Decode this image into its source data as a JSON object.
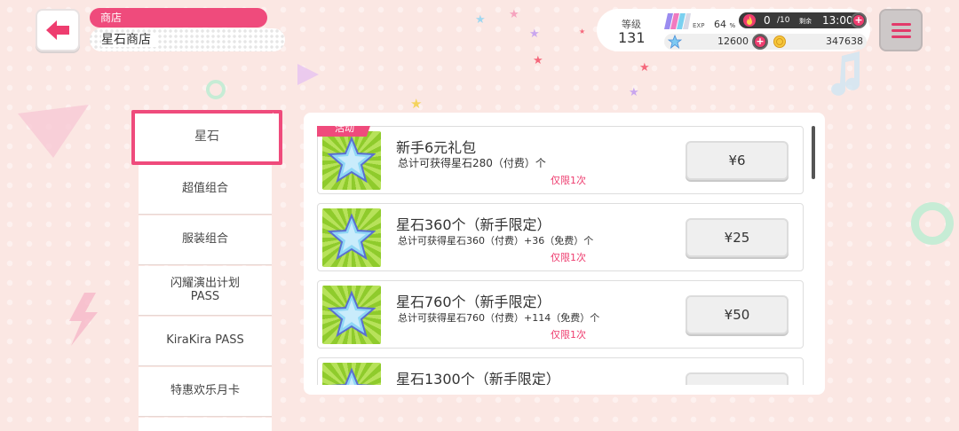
{
  "header": {
    "breadcrumb_top": "商店",
    "page_title": "星石商店"
  },
  "status": {
    "level_label": "等级",
    "level_value": "131",
    "exp_label": "EXP",
    "exp_percent": "64",
    "exp_unit": "%",
    "stamina_current": "0",
    "stamina_max": "/10",
    "remaining_label": "剩余",
    "remaining_time": "13:00",
    "gems": "12600",
    "coins": "347638"
  },
  "sidebar": {
    "items": [
      {
        "label": "星石"
      },
      {
        "label": "超值组合"
      },
      {
        "label": "服装组合"
      },
      {
        "label": "闪耀演出计划\nPASS"
      },
      {
        "label": "KiraKira PASS"
      },
      {
        "label": "特惠欢乐月卡"
      }
    ]
  },
  "products": [
    {
      "tag": "活动",
      "title": "新手6元礼包",
      "desc": "总计可获得星石280（付费）个",
      "limit": "仅限1次",
      "price": "¥6"
    },
    {
      "title": "星石360个（新手限定）",
      "desc": "总计可获得星石360（付费）+36（免费）个",
      "limit": "仅限1次",
      "price": "¥25"
    },
    {
      "title": "星石760个（新手限定）",
      "desc": "总计可获得星石760（付费）+114（免费）个",
      "limit": "仅限1次",
      "price": "¥50"
    },
    {
      "title": "星石1300个（新手限定）"
    }
  ],
  "colors": {
    "accent": "#ef4b7c",
    "background": "#fbe7e3"
  },
  "icons": {
    "back": "back-arrow-icon",
    "menu": "hamburger-menu-icon",
    "stamina": "flame-icon",
    "gem": "star-gem-icon",
    "coin": "coin-icon"
  }
}
